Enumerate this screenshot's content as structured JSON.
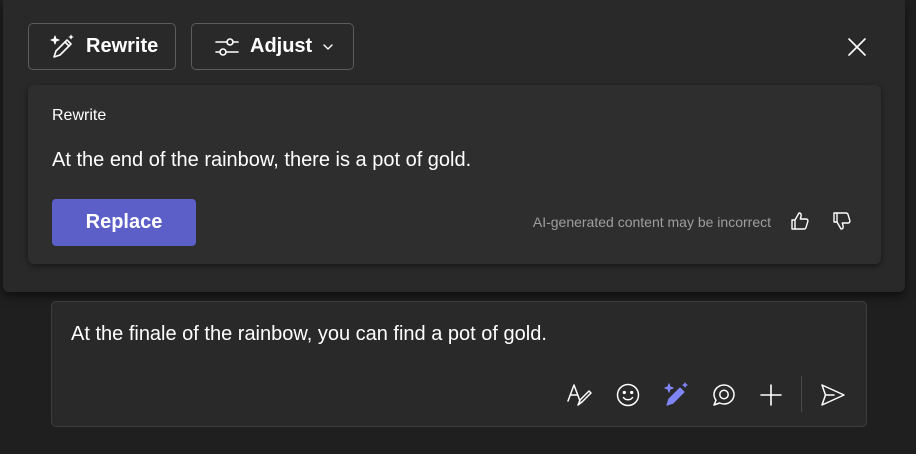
{
  "toolbar": {
    "rewrite_label": "Rewrite",
    "adjust_label": "Adjust"
  },
  "suggestion": {
    "title": "Rewrite",
    "text": "At the end of the rainbow, there is a pot of gold.",
    "replace_label": "Replace",
    "disclaimer": "AI-generated content may be incorrect"
  },
  "compose": {
    "text": "At the finale of the rainbow, you can find a pot of gold."
  },
  "icons": {
    "rewrite": "sparkle-pen-icon",
    "adjust": "sliders-icon",
    "close": "close-icon",
    "thumbs_up": "thumbs-up-icon",
    "thumbs_down": "thumbs-down-icon",
    "format": "format-text-icon",
    "emoji": "emoji-icon",
    "copilot": "copilot-rewrite-icon",
    "loop": "loop-icon",
    "add": "add-icon",
    "send": "send-icon"
  },
  "colors": {
    "accent": "#5b5fc7",
    "copilot_icon": "#7f85f5",
    "panel_bg": "#292929",
    "card_bg": "#2e2e2e",
    "page_bg": "#1f1f1f",
    "muted_text": "#9e9e9e"
  }
}
